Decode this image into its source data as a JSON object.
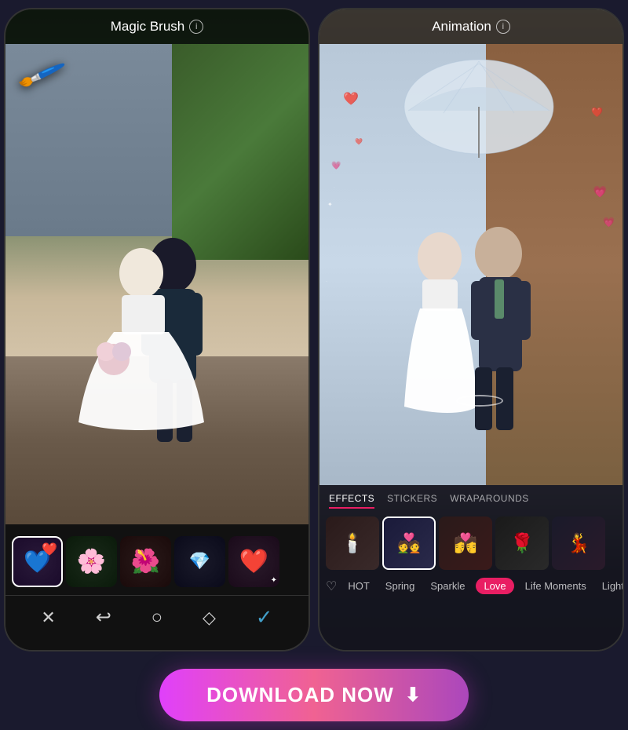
{
  "left_phone": {
    "title": "Magic Brush",
    "info_label": "i",
    "brush_icon": "✦",
    "thumbnails": [
      {
        "id": 1,
        "emoji": "💙❤️",
        "selected": true
      },
      {
        "id": 2,
        "emoji": "🌸",
        "selected": false
      },
      {
        "id": 3,
        "emoji": "🌺",
        "selected": false
      },
      {
        "id": 4,
        "emoji": "💎",
        "selected": false
      },
      {
        "id": 5,
        "emoji": "❤️",
        "selected": false
      }
    ],
    "tools": [
      "✕",
      "↩",
      "○",
      "◇",
      "✓"
    ]
  },
  "right_phone": {
    "title": "Animation",
    "info_label": "i",
    "tabs": [
      "EFFECTS",
      "STICKERS",
      "WRAPAROUNDS"
    ],
    "active_tab": "EFFECTS",
    "effect_thumbnails": [
      {
        "id": 1,
        "selected": false
      },
      {
        "id": 2,
        "selected": true
      },
      {
        "id": 3,
        "selected": false
      },
      {
        "id": 4,
        "selected": false
      },
      {
        "id": 5,
        "selected": false
      }
    ],
    "filters": [
      {
        "label": "♡",
        "type": "heart"
      },
      {
        "label": "HOT",
        "active": false
      },
      {
        "label": "Spring",
        "active": false
      },
      {
        "label": "Sparkle",
        "active": false
      },
      {
        "label": "Love",
        "active": true
      },
      {
        "label": "Life Moments",
        "active": false
      },
      {
        "label": "Light",
        "active": false
      }
    ]
  },
  "download_button": {
    "label": "DOWNLOAD NOW",
    "icon": "⬇"
  }
}
